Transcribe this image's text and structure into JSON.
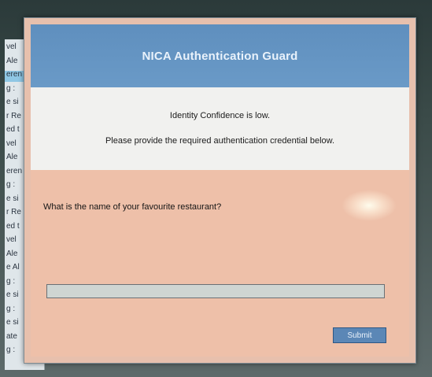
{
  "dialog": {
    "title": "NICA Authentication Guard",
    "message_line1": "Identity Confidence is low.",
    "message_line2": "Please provide the required authentication credential below.",
    "question": "What is the name of your favourite restaurant?",
    "answer_value": "",
    "submit_label": "Submit"
  },
  "background_window": {
    "lines": [
      "vel",
      "Ale",
      "eren",
      "g :",
      "e si",
      "r Re",
      "ed t",
      "vel",
      "Ale",
      "eren",
      "g :",
      "e si",
      "r Re",
      "ed t",
      "vel",
      "Ale",
      "e Al",
      "g :",
      "e si",
      "g :",
      "e si",
      "ate",
      "g :"
    ]
  },
  "colors": {
    "titlebar": "#5f8fbe",
    "dialog_body": "#eec0a9",
    "info_panel": "#f1f1ef",
    "submit_button": "#5b87b6"
  }
}
